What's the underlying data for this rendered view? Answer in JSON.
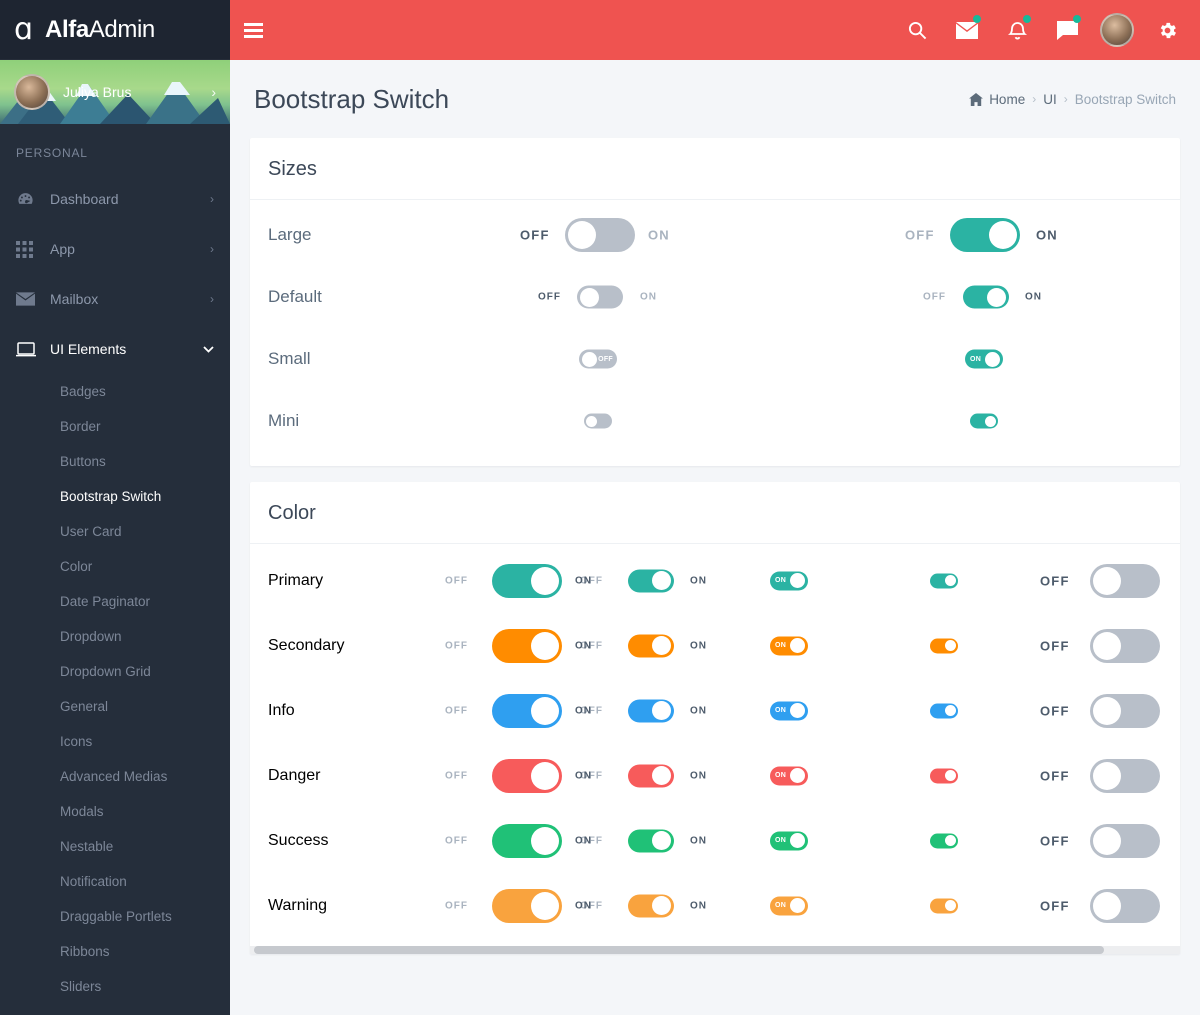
{
  "brand": {
    "logo_icon": "alpha-icon",
    "name_bold": "Alfa",
    "name_light": "Admin"
  },
  "sidebar": {
    "user": {
      "name": "Juliya Brus",
      "chevron": "›",
      "avatar_icon": "avatar"
    },
    "section_label": "PERSONAL",
    "items": [
      {
        "label": "Dashboard",
        "icon": "dashboard-icon",
        "chevron": "›"
      },
      {
        "label": "App",
        "icon": "grid-icon",
        "chevron": "›"
      },
      {
        "label": "Mailbox",
        "icon": "envelope-icon",
        "chevron": "›"
      },
      {
        "label": "UI Elements",
        "icon": "monitor-icon",
        "chevron": "⌄",
        "active": true
      }
    ],
    "subitems": [
      {
        "label": "Badges"
      },
      {
        "label": "Border"
      },
      {
        "label": "Buttons"
      },
      {
        "label": "Bootstrap Switch",
        "active": true
      },
      {
        "label": "User Card"
      },
      {
        "label": "Color"
      },
      {
        "label": "Date Paginator"
      },
      {
        "label": "Dropdown"
      },
      {
        "label": "Dropdown Grid"
      },
      {
        "label": "General"
      },
      {
        "label": "Icons"
      },
      {
        "label": "Advanced Medias"
      },
      {
        "label": "Modals"
      },
      {
        "label": "Nestable"
      },
      {
        "label": "Notification"
      },
      {
        "label": "Draggable Portlets"
      },
      {
        "label": "Ribbons"
      },
      {
        "label": "Sliders"
      }
    ]
  },
  "topbar": {
    "background": "#ef5350",
    "menu_toggle": "hamburger-icon",
    "icons": [
      {
        "name": "search-icon",
        "badge": false
      },
      {
        "name": "mail-icon",
        "badge": true
      },
      {
        "name": "bell-icon",
        "badge": true
      },
      {
        "name": "chat-icon",
        "badge": true
      }
    ],
    "avatar": "user-avatar",
    "settings": "gear-icon",
    "badge_color": "#19b99a"
  },
  "page": {
    "title": "Bootstrap Switch",
    "breadcrumb": {
      "home": "Home",
      "home_icon": "home-icon",
      "sep": "›",
      "middle": "UI",
      "current": "Bootstrap Switch"
    }
  },
  "labels": {
    "on": "ON",
    "off": "OFF"
  },
  "sizes_card": {
    "title": "Sizes",
    "rows": [
      {
        "label": "Large",
        "size": "lg",
        "left_state": "off",
        "right_state": "on",
        "show_text": true,
        "inline": false
      },
      {
        "label": "Default",
        "size": "df",
        "left_state": "off",
        "right_state": "on",
        "show_text": true,
        "inline": false
      },
      {
        "label": "Small",
        "size": "sm",
        "left_state": "off",
        "right_state": "on",
        "show_text": false,
        "inline": true
      },
      {
        "label": "Mini",
        "size": "mn",
        "left_state": "off",
        "right_state": "on",
        "show_text": false,
        "inline": false
      }
    ]
  },
  "color_card": {
    "title": "Color",
    "colors": [
      {
        "label": "Primary",
        "hex": "#2bb3a3"
      },
      {
        "label": "Secondary",
        "hex": "#ff8c00"
      },
      {
        "label": "Info",
        "hex": "#2f9ff0"
      },
      {
        "label": "Danger",
        "hex": "#f75b5b"
      },
      {
        "label": "Success",
        "hex": "#20c177"
      },
      {
        "label": "Warning",
        "hex": "#f9a33e"
      }
    ],
    "off_switch_color": "#b8bfc9",
    "scrollbar": {
      "visible": true
    }
  }
}
